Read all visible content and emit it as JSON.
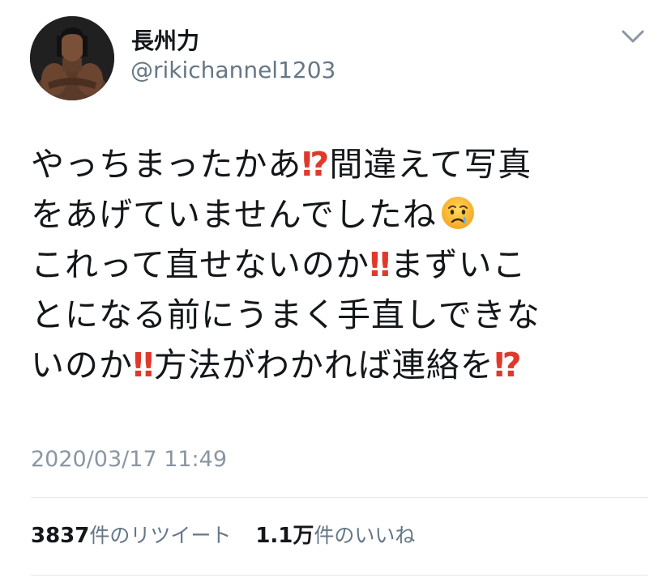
{
  "author": {
    "name": "長州力",
    "handle": "@rikichannel1203",
    "avatar_icon": "profile-photo"
  },
  "tweet": {
    "lines": [
      {
        "text": "やっちまったかあ",
        "mark": "⁉",
        "rest": "間違えて写真"
      },
      {
        "text": "をあげていませんでしたね",
        "emoji": "crying-face-icon"
      },
      {
        "text": "これって直せないのか",
        "mark": "‼",
        "rest": "まずいこ"
      },
      {
        "text": "とになる前にうまく手直しできな"
      },
      {
        "text": "いのか",
        "mark": "‼",
        "rest": "方法がわかれば連絡を",
        "mark_end": "⁉"
      }
    ],
    "timestamp": "2020/03/17 11:49"
  },
  "stats": {
    "retweets_count": "3837",
    "retweets_label": "件のリツイート",
    "likes_count": "1.1万",
    "likes_label": "件のいいね"
  },
  "colors": {
    "text": "#14171a",
    "secondary": "#657786",
    "divider": "#e1e8ed",
    "exclamation": "#e0392b"
  }
}
